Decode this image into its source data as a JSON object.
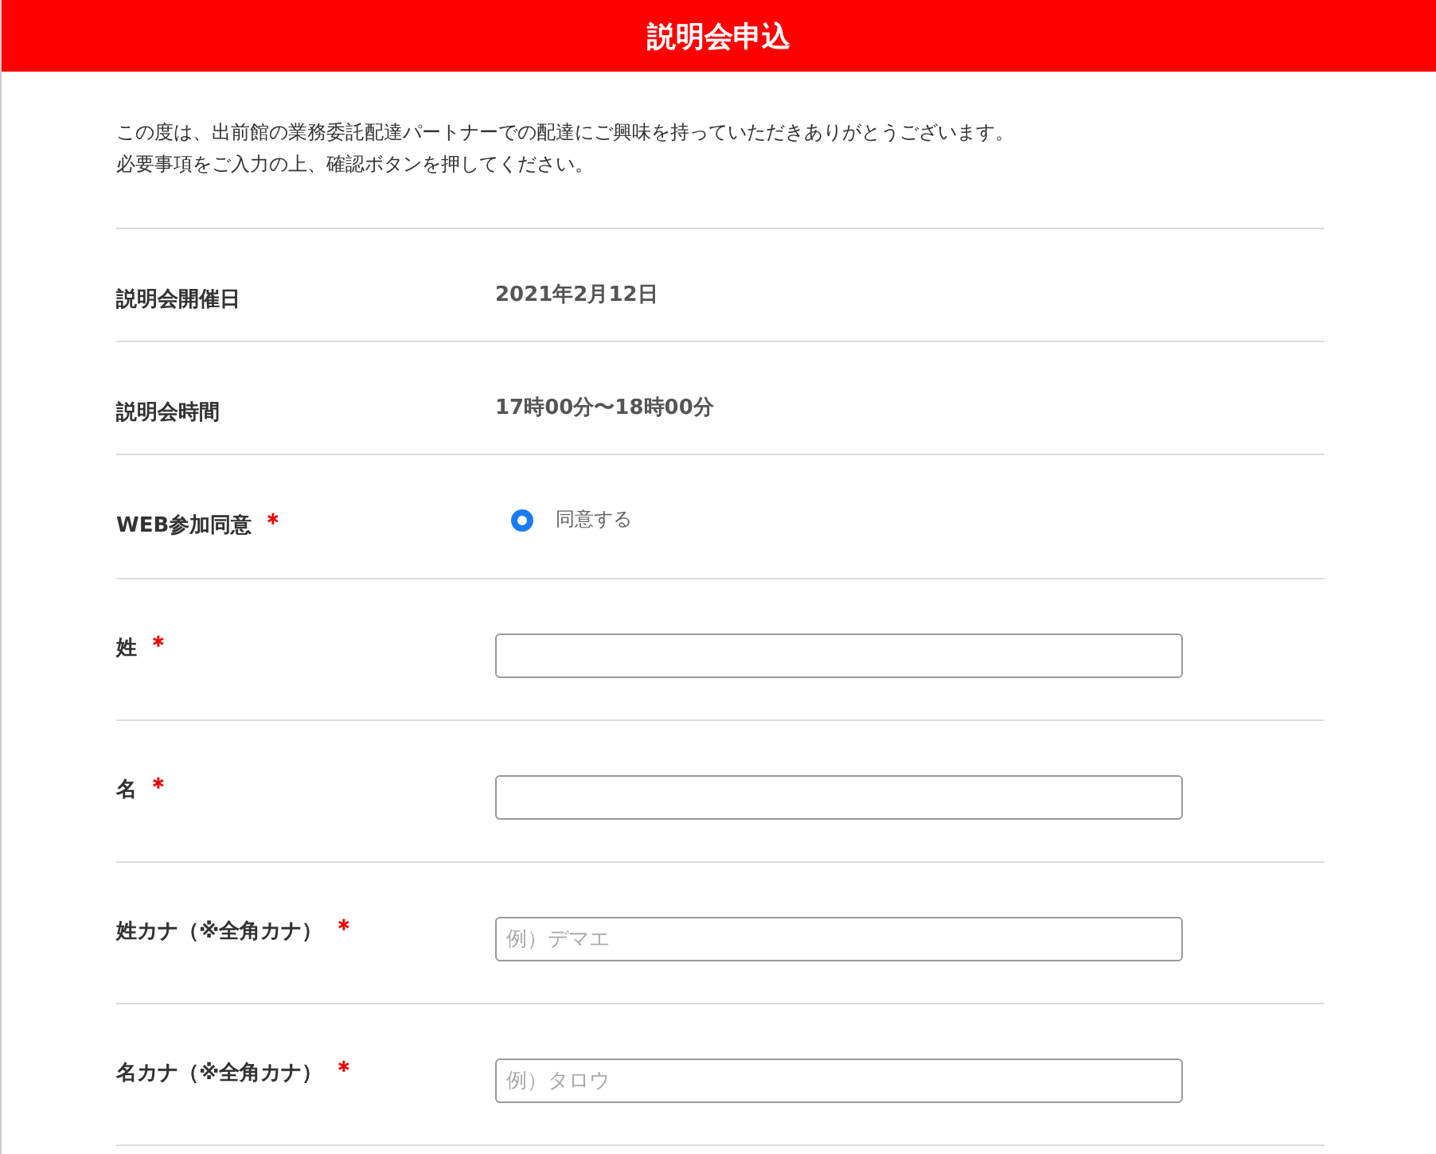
{
  "header": {
    "title": "説明会申込"
  },
  "intro": [
    "この度は、出前館の業務委託配達パートナーでの配達にご興味を持っていただきありがとうございます。",
    "必要事項をご入力の上、確認ボタンを押してください。"
  ],
  "fields": [
    {
      "kind": "static",
      "label": "説明会開催日",
      "value": "2021年2月12日"
    },
    {
      "kind": "static",
      "label": "説明会時間",
      "value": "17時00分〜18時00分"
    },
    {
      "kind": "radio",
      "label": "WEB参加同意",
      "mark": "＊",
      "option": "同意する",
      "selected": true
    },
    {
      "kind": "text",
      "label": "姓",
      "mark": "＊"
    },
    {
      "kind": "text",
      "label": "名",
      "mark": "＊"
    },
    {
      "kind": "text",
      "label": "姓カナ（※全角カナ）",
      "mark": "＊",
      "placeholder": "例）デマエ"
    },
    {
      "kind": "text",
      "label": "名カナ（※全角カナ）",
      "mark": "＊",
      "placeholder": "例）タロウ"
    }
  ]
}
